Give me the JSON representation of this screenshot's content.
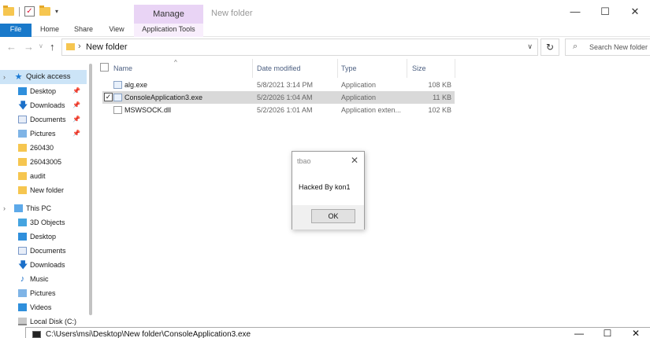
{
  "titlebar": {
    "manage_tab": "Manage",
    "title": "New folder",
    "minimize": "—",
    "maximize": "☐",
    "close": "✕"
  },
  "ribbon": {
    "file": "File",
    "home": "Home",
    "share": "Share",
    "view": "View",
    "app_tools": "Application Tools"
  },
  "navbar": {
    "back": "←",
    "forward": "→",
    "recent": "∨",
    "up": "↑",
    "path": "New folder",
    "refresh": "↻",
    "search_placeholder": "Search New folder"
  },
  "sidebar": {
    "quick_access": "Quick access",
    "quick_items": [
      {
        "label": "Desktop",
        "icon": "desktop-icon",
        "pinned": true
      },
      {
        "label": "Downloads",
        "icon": "downloads-icon",
        "pinned": true
      },
      {
        "label": "Documents",
        "icon": "documents-icon",
        "pinned": true
      },
      {
        "label": "Pictures",
        "icon": "pictures-icon",
        "pinned": true
      },
      {
        "label": "260430",
        "icon": "folder-icon",
        "pinned": false
      },
      {
        "label": "26043005",
        "icon": "folder-icon",
        "pinned": false
      },
      {
        "label": "audit",
        "icon": "folder-icon",
        "pinned": false
      },
      {
        "label": "New folder",
        "icon": "folder-icon",
        "pinned": false
      }
    ],
    "this_pc": "This PC",
    "pc_items": [
      {
        "label": "3D Objects",
        "icon": "3d-objects-icon"
      },
      {
        "label": "Desktop",
        "icon": "desktop-icon"
      },
      {
        "label": "Documents",
        "icon": "documents-icon"
      },
      {
        "label": "Downloads",
        "icon": "downloads-icon"
      },
      {
        "label": "Music",
        "icon": "music-icon"
      },
      {
        "label": "Pictures",
        "icon": "pictures-icon"
      },
      {
        "label": "Videos",
        "icon": "videos-icon"
      },
      {
        "label": "Local Disk (C:)",
        "icon": "disk-icon"
      }
    ]
  },
  "filelist": {
    "headers": {
      "name": "Name",
      "date": "Date modified",
      "type": "Type",
      "size": "Size"
    },
    "rows": [
      {
        "name": "alg.exe",
        "date": "5/8/2021 3:14 PM",
        "type": "Application",
        "size": "108 KB",
        "selected": false,
        "icon": "exe-icon"
      },
      {
        "name": "ConsoleApplication3.exe",
        "date": "5/2/2026 1:04 AM",
        "type": "Application",
        "size": "11 KB",
        "selected": true,
        "icon": "exe-icon"
      },
      {
        "name": "MSWSOCK.dll",
        "date": "5/2/2026 1:01 AM",
        "type": "Application exten...",
        "size": "102 KB",
        "selected": false,
        "icon": "dll-icon"
      }
    ]
  },
  "msgbox": {
    "title": "tbao",
    "text": "Hacked By kon1",
    "ok": "OK",
    "close": "✕"
  },
  "console": {
    "title": "C:\\Users\\msi\\Desktop\\New folder\\ConsoleApplication3.exe",
    "minimize": "—",
    "maximize": "☐",
    "close": "✕"
  }
}
